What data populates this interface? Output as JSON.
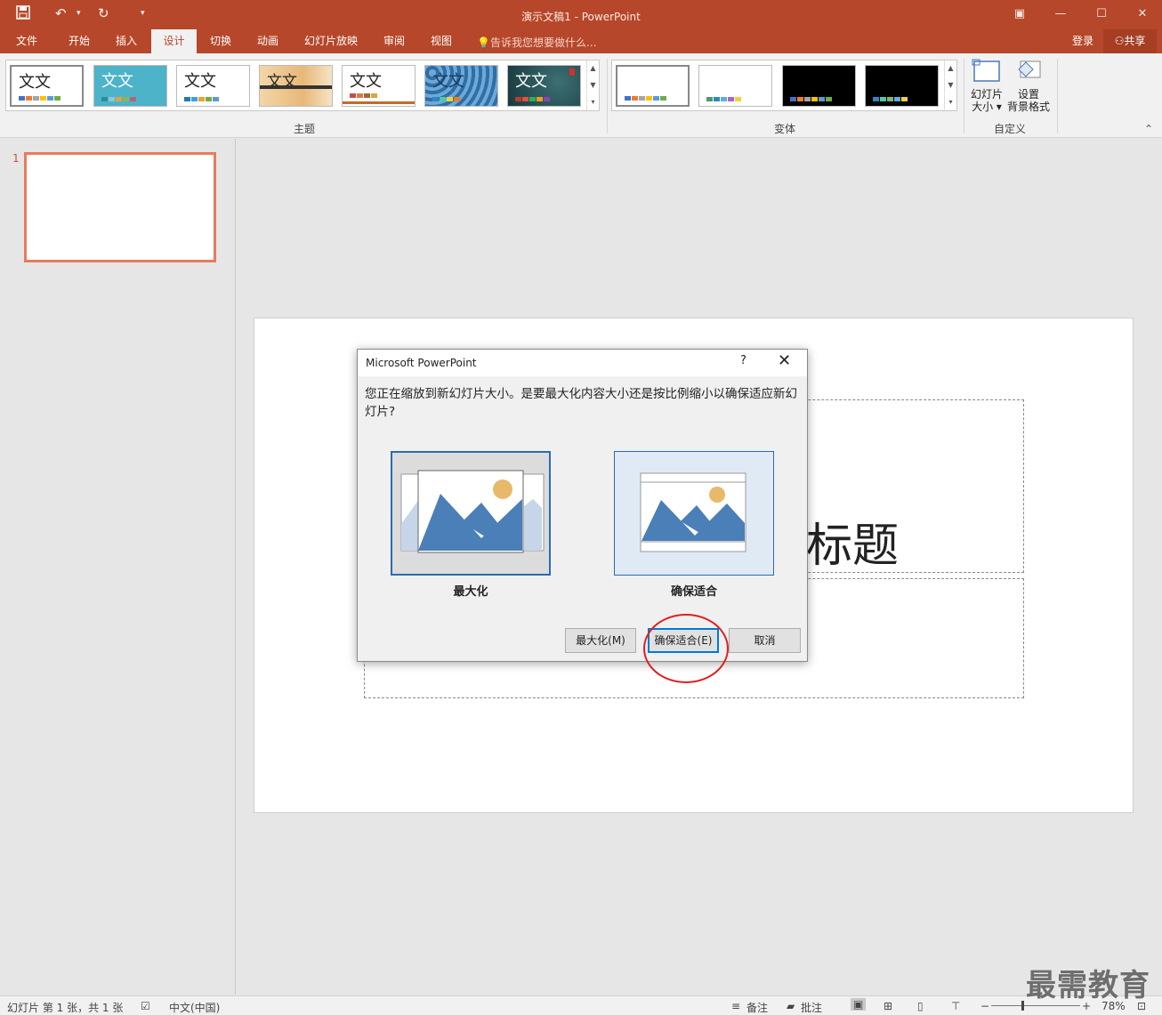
{
  "app": {
    "doc_title": "演示文稿1 - PowerPoint"
  },
  "qat": {
    "save_icon": "save-icon",
    "undo_icon": "undo-icon",
    "redo_icon": "redo-icon",
    "customize_icon": "chevron-down-icon"
  },
  "window": {
    "ribbon_options": "▣",
    "minimize": "—",
    "maximize": "☐",
    "close": "✕"
  },
  "tabs": [
    "文件",
    "开始",
    "插入",
    "设计",
    "切换",
    "动画",
    "幻灯片放映",
    "审阅",
    "视图"
  ],
  "active_tab": "设计",
  "tellme": "告诉我您想要做什么...",
  "account": {
    "signin": "登录",
    "share": "共享"
  },
  "ribbon": {
    "themes_label": "主题",
    "variants_label": "变体",
    "customize_label": "自定义",
    "theme_thumb_text": "文文",
    "slide_size_line1": "幻灯片",
    "slide_size_line2": "大小 ▾",
    "format_bg_line1": "设置",
    "format_bg_line2": "背景格式",
    "collapse": "⌃"
  },
  "slide_panel": {
    "number": "1"
  },
  "slide": {
    "title_visible": "标题"
  },
  "dialog": {
    "title": "Microsoft PowerPoint",
    "help": "?",
    "close": "✕",
    "message": "您正在缩放到新幻灯片大小。是要最大化内容大小还是按比例缩小以确保适应新幻灯片?",
    "option_maximize": "最大化",
    "option_ensure_fit": "确保适合",
    "btn_maximize": "最大化(M)",
    "btn_ensure_fit": "确保适合(E)",
    "btn_cancel": "取消"
  },
  "status": {
    "slide_info": "幻灯片 第 1 张，共 1 张",
    "language": "中文(中国)",
    "notes": "备注",
    "comments": "批注",
    "zoom": "78%"
  },
  "watermark": "最需教育",
  "colors": {
    "accent": "#b7472a",
    "dialog_border": "#2b6cb0",
    "highlight_circle": "#e02020"
  }
}
